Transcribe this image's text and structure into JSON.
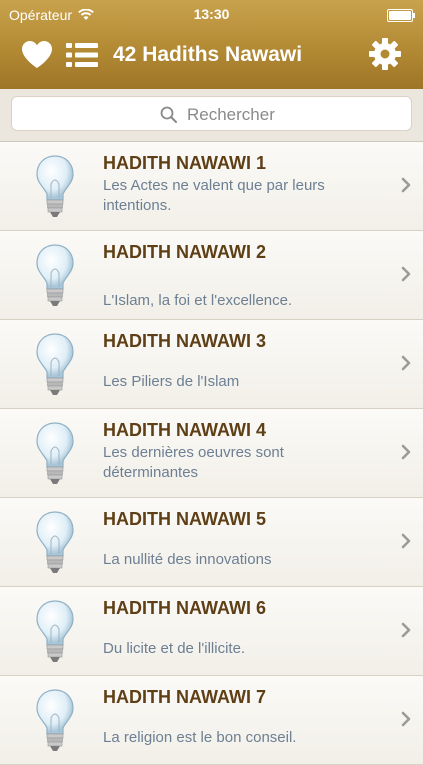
{
  "status": {
    "carrier": "Opérateur",
    "time": "13:30"
  },
  "header": {
    "title": "42 Hadiths Nawawi"
  },
  "search": {
    "placeholder": "Rechercher"
  },
  "items": [
    {
      "title": "HADITH NAWAWI 1",
      "subtitle": "Les Actes ne valent que par leurs intentions."
    },
    {
      "title": "HADITH NAWAWI 2",
      "subtitle": "L'Islam, la foi et l'excellence."
    },
    {
      "title": "HADITH NAWAWI 3",
      "subtitle": "Les Piliers de l'Islam"
    },
    {
      "title": "HADITH NAWAWI 4",
      "subtitle": "Les dernières oeuvres sont déterminantes"
    },
    {
      "title": "HADITH NAWAWI 5",
      "subtitle": "La nullité des innovations"
    },
    {
      "title": "HADITH NAWAWI 6",
      "subtitle": "Du licite et de l'illicite."
    },
    {
      "title": "HADITH NAWAWI 7",
      "subtitle": "La religion est le bon conseil."
    }
  ],
  "colors": {
    "navbar": "#b38a34",
    "title_text": "#5e3f16",
    "subtitle_text": "#6d7f93",
    "chevron": "#9b9b9b"
  },
  "icons": {
    "favorites": "heart-icon",
    "list": "list-icon",
    "settings": "gear-icon",
    "search": "search-icon",
    "item": "lightbulb-icon",
    "disclosure": "chevron-right-icon"
  }
}
